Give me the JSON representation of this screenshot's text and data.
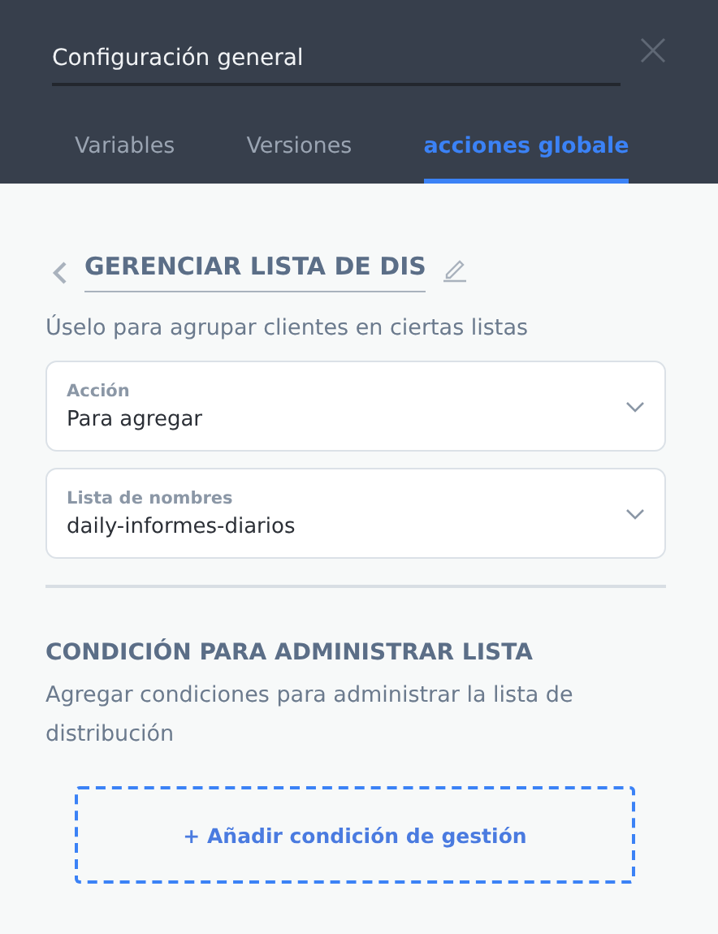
{
  "header": {
    "title_value": "Configuración general"
  },
  "tabs": [
    {
      "label": "Variables",
      "selected": false
    },
    {
      "label": "Versiones",
      "selected": false
    },
    {
      "label": "acciones globale",
      "selected": true
    }
  ],
  "action": {
    "name": "GERENCIAR LISTA DE DIS",
    "description": "Úselo para agrupar clientes en ciertas listas"
  },
  "selects": [
    {
      "label": "Acción",
      "value": "Para agregar"
    },
    {
      "label": "Lista de nombres",
      "value": "daily-informes-diarios"
    }
  ],
  "condition": {
    "heading": "CONDICIÓN PARA ADMINISTRAR LISTA",
    "description": "Agregar condiciones para administrar la lista de distribución",
    "add_button": "+ Añadir condición de gestión"
  }
}
